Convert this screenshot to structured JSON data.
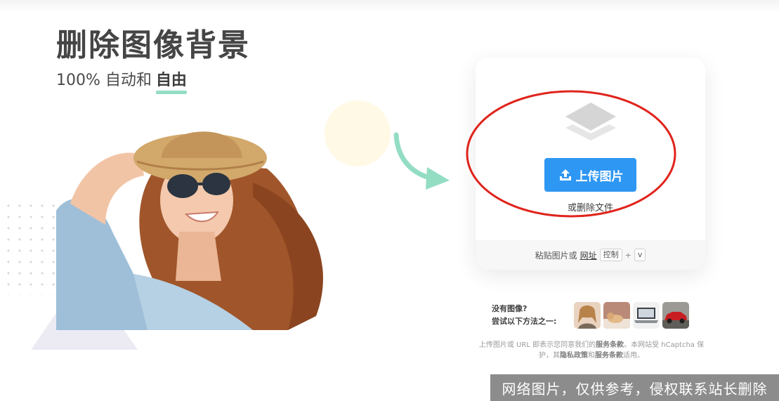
{
  "hero": {
    "title": "删除图像背景",
    "subtitle_prefix": "100% 自动和",
    "subtitle_emphasis": "自由"
  },
  "upload": {
    "button_label": "上传图片",
    "drop_text": "或删除文件",
    "paste_prefix": "粘贴图片或",
    "paste_link": "网址",
    "key_ctrl": "控制",
    "key_plus": "+",
    "key_v": "v"
  },
  "samples": {
    "line1": "没有图像?",
    "line2": "尝试以下方法之一:",
    "thumbs": [
      "sample-woman-thumb",
      "sample-animal-thumb",
      "sample-laptop-thumb",
      "sample-car-thumb"
    ]
  },
  "terms": {
    "part1": "上传图片或 URL 即表示您同意我们的",
    "link1": "服务条款",
    "part2": "。本网站受 hCaptcha 保护，其",
    "link2": "隐私政策",
    "part3": "和",
    "link3": "服务条款",
    "part4": "适用。"
  },
  "watermark": "网络图片，仅供参考，侵权联系站长删除",
  "colors": {
    "accent_blue": "#2e97f3",
    "accent_mint": "#93ddc3",
    "annotation_red": "#e0241c"
  }
}
